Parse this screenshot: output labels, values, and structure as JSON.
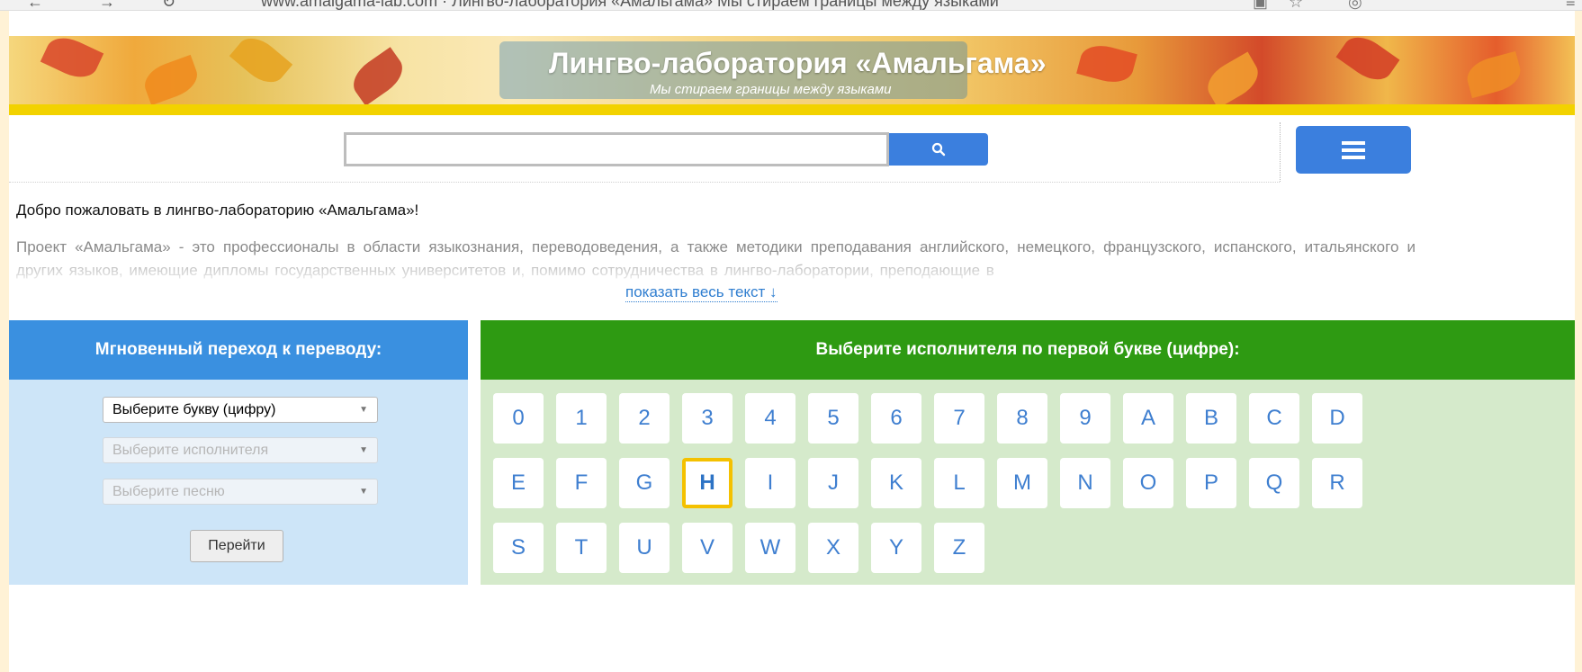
{
  "browser": {
    "url": "www.amalgama-lab.com · Лингво-лаборатория «Амальгама» Мы стираем границы между языками"
  },
  "banner": {
    "title": "Лингво-лаборатория «Амальгама»",
    "subtitle": "Мы стираем границы между языками"
  },
  "search": {
    "placeholder": "",
    "button_icon": "search-icon"
  },
  "menu": {
    "icon": "hamburger-menu-icon"
  },
  "intro": {
    "welcome": "Добро пожаловать в лингво-лабораторию «Амальгама»!",
    "text": "Проект «Амальгама» - это профессионалы в области языкознания, переводоведения, а также методики преподавания английского, немецкого, французского, испанского, итальянского и других языков, имеющие дипломы государственных университетов и, помимо сотрудничества в лингво-лаборатории, преподающие в",
    "show_more": "показать весь текст ↓"
  },
  "quick_jump": {
    "header": "Мгновенный переход к переводу:",
    "select_letter": "Выберите букву (цифру)",
    "select_artist": "Выберите исполнителя",
    "select_song": "Выберите песню",
    "go_label": "Перейти"
  },
  "letters_panel": {
    "header": "Выберите исполнителя по первой букве (цифре):",
    "selected": "H",
    "letters": [
      "0",
      "1",
      "2",
      "3",
      "4",
      "5",
      "6",
      "7",
      "8",
      "9",
      "A",
      "B",
      "C",
      "D",
      "E",
      "F",
      "G",
      "H",
      "I",
      "J",
      "K",
      "L",
      "M",
      "N",
      "O",
      "P",
      "Q",
      "R",
      "S",
      "T",
      "U",
      "V",
      "W",
      "X",
      "Y",
      "Z"
    ]
  },
  "colors": {
    "accent_blue": "#3b7fde",
    "panel_blue_header": "#3a90e0",
    "panel_green_header": "#2e9a12",
    "highlight_yellow": "#f4c100"
  }
}
